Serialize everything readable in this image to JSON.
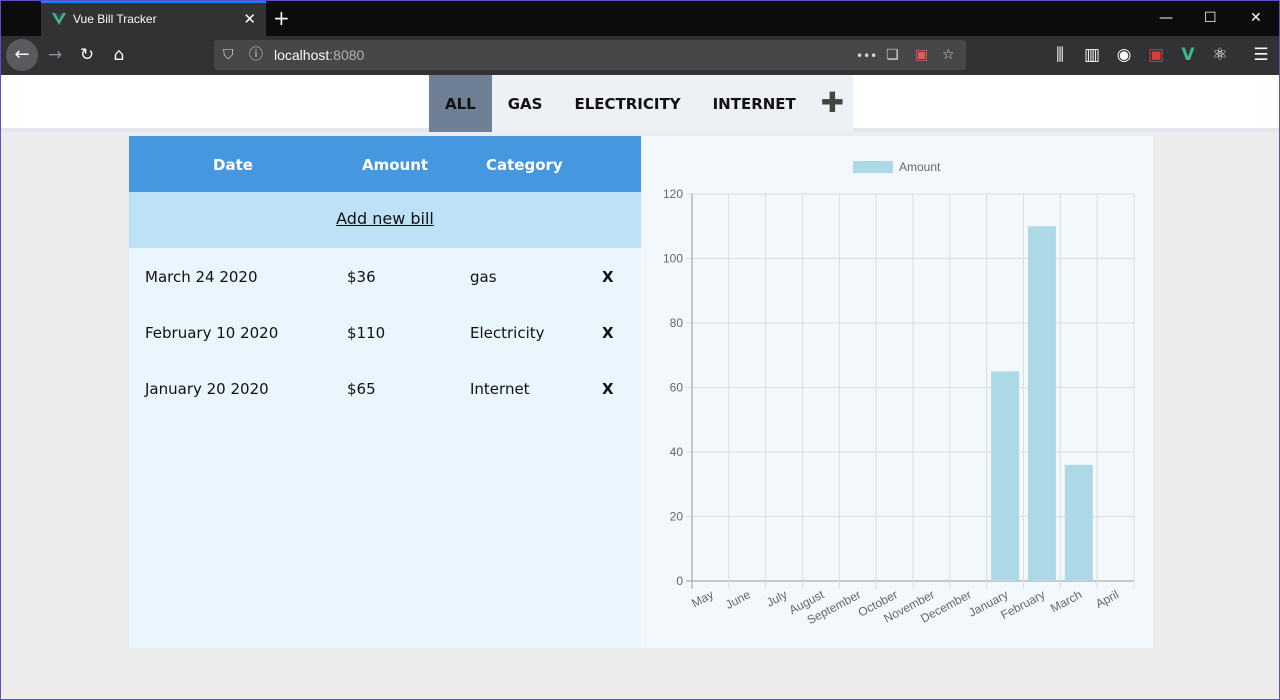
{
  "browser": {
    "tab_title": "Vue Bill Tracker",
    "tab_close": "✕",
    "new_tab": "+",
    "url_host": "localhost",
    "url_port": ":8080",
    "controls": {
      "minimize": "—",
      "maximize": "☐",
      "close": "✕"
    },
    "nav_icons": {
      "back": "←",
      "forward": "→",
      "reload": "↻",
      "home": "⌂",
      "more": "•••",
      "pocket": "❏",
      "star": "☆",
      "library": "⫼",
      "sidebar": "▥",
      "account": "◉",
      "pdf": "▣",
      "vue": "V",
      "react": "⚛",
      "menu": "☰",
      "shield": "⛉",
      "info": "ⓘ"
    }
  },
  "nav": {
    "tabs": [
      {
        "label": "ALL",
        "active": true
      },
      {
        "label": "GAS",
        "active": false
      },
      {
        "label": "ELECTRICITY",
        "active": false
      },
      {
        "label": "INTERNET",
        "active": false
      }
    ],
    "add_icon": "✚"
  },
  "bills": {
    "headers": {
      "date": "Date",
      "amount": "Amount",
      "category": "Category"
    },
    "add_label": "Add new bill",
    "delete_label": "X",
    "rows": [
      {
        "date": "March 24 2020",
        "amount": "$36",
        "category": "gas"
      },
      {
        "date": "February 10 2020",
        "amount": "$110",
        "category": "Electricity"
      },
      {
        "date": "January 20 2020",
        "amount": "$65",
        "category": "Internet"
      }
    ]
  },
  "colors": {
    "header_blue": "#4597e0",
    "add_row": "#bde2f8",
    "bar": "#add8e6",
    "active_tab": "#6e7f96"
  },
  "chart_data": {
    "type": "bar",
    "categories": [
      "May",
      "June",
      "July",
      "August",
      "September",
      "October",
      "November",
      "December",
      "January",
      "February",
      "March",
      "April"
    ],
    "series": [
      {
        "name": "Amount",
        "values": [
          0,
          0,
          0,
          0,
          0,
          0,
          0,
          0,
          65,
          110,
          36,
          0
        ]
      }
    ],
    "ylim": [
      0,
      120
    ],
    "yticks": [
      0,
      20,
      40,
      60,
      80,
      100,
      120
    ],
    "grid": true,
    "legend": "top"
  }
}
